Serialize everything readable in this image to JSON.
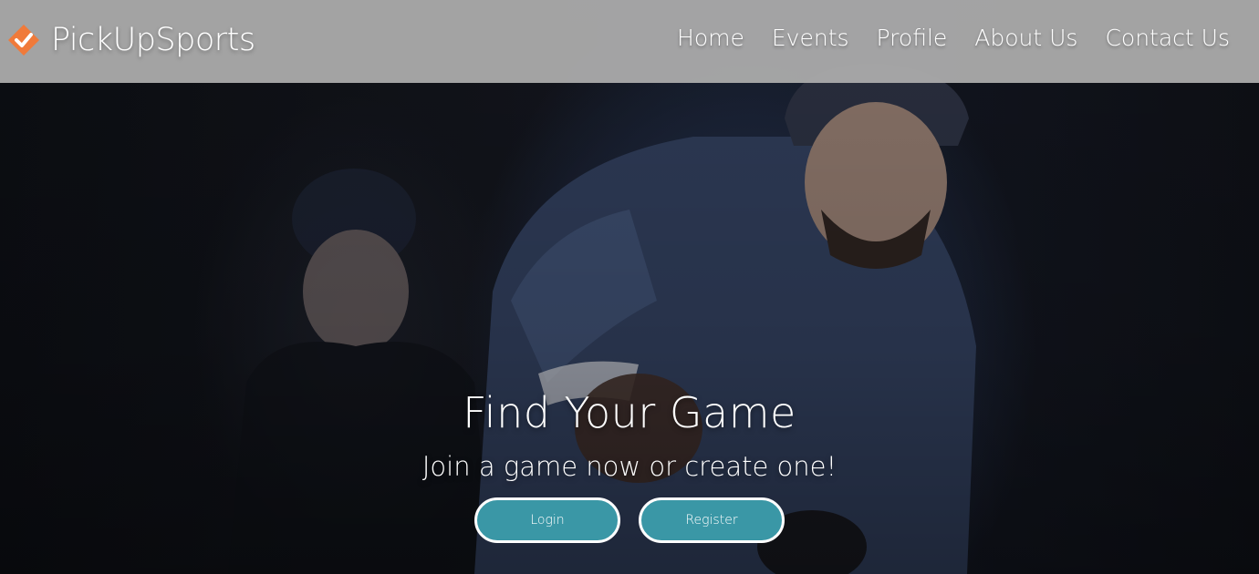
{
  "brand": {
    "name": "PickUpSports",
    "logo_icon": "diamond-check-icon",
    "logo_color": "#f07a3a"
  },
  "nav": {
    "items": [
      {
        "label": "Home"
      },
      {
        "label": "Events"
      },
      {
        "label": "Profile"
      },
      {
        "label": "About Us"
      },
      {
        "label": "Contact Us"
      }
    ]
  },
  "hero": {
    "title": "Find Your Game",
    "subtitle": "Join a game now or create one!",
    "login_label": "Login",
    "register_label": "Register",
    "background_image": "hockey-players-photo"
  },
  "colors": {
    "navbar_bg": "#a8a8a8",
    "button_bg": "#3a97a6",
    "button_border": "#ffffff"
  }
}
